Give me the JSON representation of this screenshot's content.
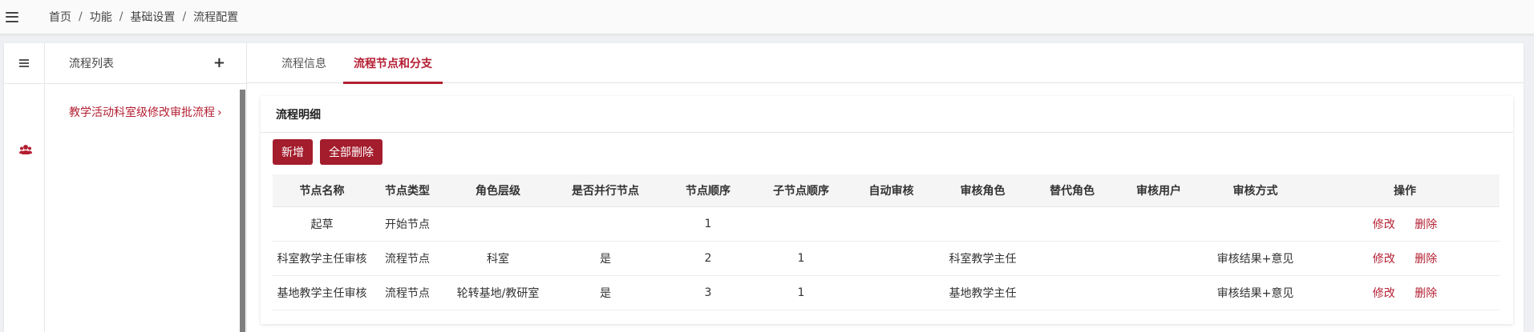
{
  "breadcrumb": [
    "首页",
    "功能",
    "基础设置",
    "流程配置"
  ],
  "breadcrumb_separator": "/",
  "flowlist": {
    "title": "流程列表",
    "add_symbol": "+",
    "items": [
      {
        "label": "教学活动科室级修改审批流程",
        "chevron": "›"
      }
    ]
  },
  "tabs": [
    {
      "label": "流程信息",
      "active": false
    },
    {
      "label": "流程节点和分支",
      "active": true
    }
  ],
  "card": {
    "title": "流程明细",
    "buttons": {
      "add": "新增",
      "delete_all": "全部删除"
    }
  },
  "table": {
    "headers": [
      "节点名称",
      "节点类型",
      "角色层级",
      "是否并行节点",
      "节点顺序",
      "子节点顺序",
      "自动审核",
      "审核角色",
      "替代角色",
      "审核用户",
      "审核方式",
      "操作"
    ],
    "rows": [
      [
        "起草",
        "开始节点",
        "",
        "",
        "1",
        "",
        "",
        "",
        "",
        "",
        ""
      ],
      [
        "科室教学主任审核",
        "流程节点",
        "科室",
        "是",
        "2",
        "1",
        "",
        "科室教学主任",
        "",
        "",
        "审核结果+意见"
      ],
      [
        "基地教学主任审核",
        "流程节点",
        "轮转基地/教研室",
        "是",
        "3",
        "1",
        "",
        "基地教学主任",
        "",
        "",
        "审核结果+意见"
      ]
    ],
    "actions": {
      "edit": "修改",
      "delete": "删除"
    }
  },
  "colors": {
    "accent": "#b41f32",
    "button": "#a41d2d"
  },
  "icons": {
    "menu": "hamburger-icon",
    "users": "users-icon",
    "add": "plus-icon"
  }
}
